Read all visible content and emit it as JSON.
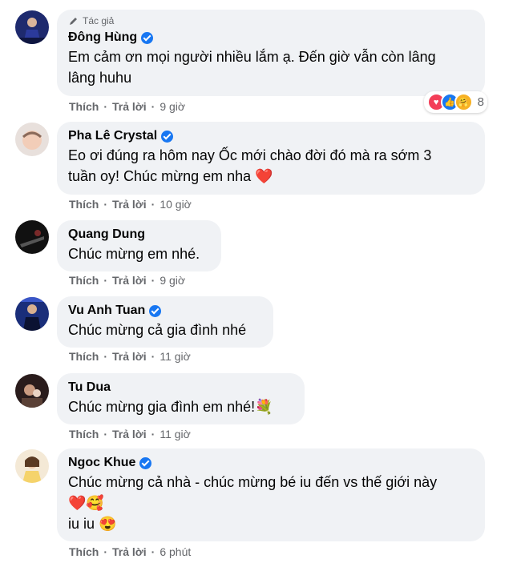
{
  "labels": {
    "like": "Thích",
    "reply": "Trả lời",
    "author_badge": "Tác giả"
  },
  "comments": [
    {
      "name": "Đông Hùng",
      "verified": true,
      "author": true,
      "lines": [
        "Em cảm ơn mọi người nhiều lắm ạ. Đến giờ vẫn còn lâng",
        "lâng huhu"
      ],
      "time": "9 giờ",
      "reaction_count": "8"
    },
    {
      "name": "Pha Lê Crystal",
      "verified": true,
      "lines": [
        "Eo ơi đúng ra hôm nay Ốc mới chào đời đó mà ra sớm 3",
        "tuần oy! Chúc mừng em nha ❤️"
      ],
      "time": "10 giờ"
    },
    {
      "name": "Quang Dung",
      "verified": false,
      "lines": [
        "Chúc mừng em nhé."
      ],
      "time": "9 giờ"
    },
    {
      "name": "Vu Anh Tuan",
      "verified": true,
      "lines": [
        "Chúc mừng cả gia đình nhé"
      ],
      "time": "11 giờ"
    },
    {
      "name": "Tu Dua",
      "verified": false,
      "lines": [
        "Chúc mừng gia đình em nhé!💐"
      ],
      "time": "11 giờ"
    },
    {
      "name": "Ngoc Khue",
      "verified": true,
      "lines": [
        "Chúc mừng cả nhà - chúc mừng bé iu đến vs thế giới này",
        "❤️🥰",
        "iu iu 😍"
      ],
      "time": "6 phút"
    }
  ],
  "colors": {
    "bubble": "#f0f2f5",
    "verified": "#1877f2",
    "meta": "#65676b"
  }
}
